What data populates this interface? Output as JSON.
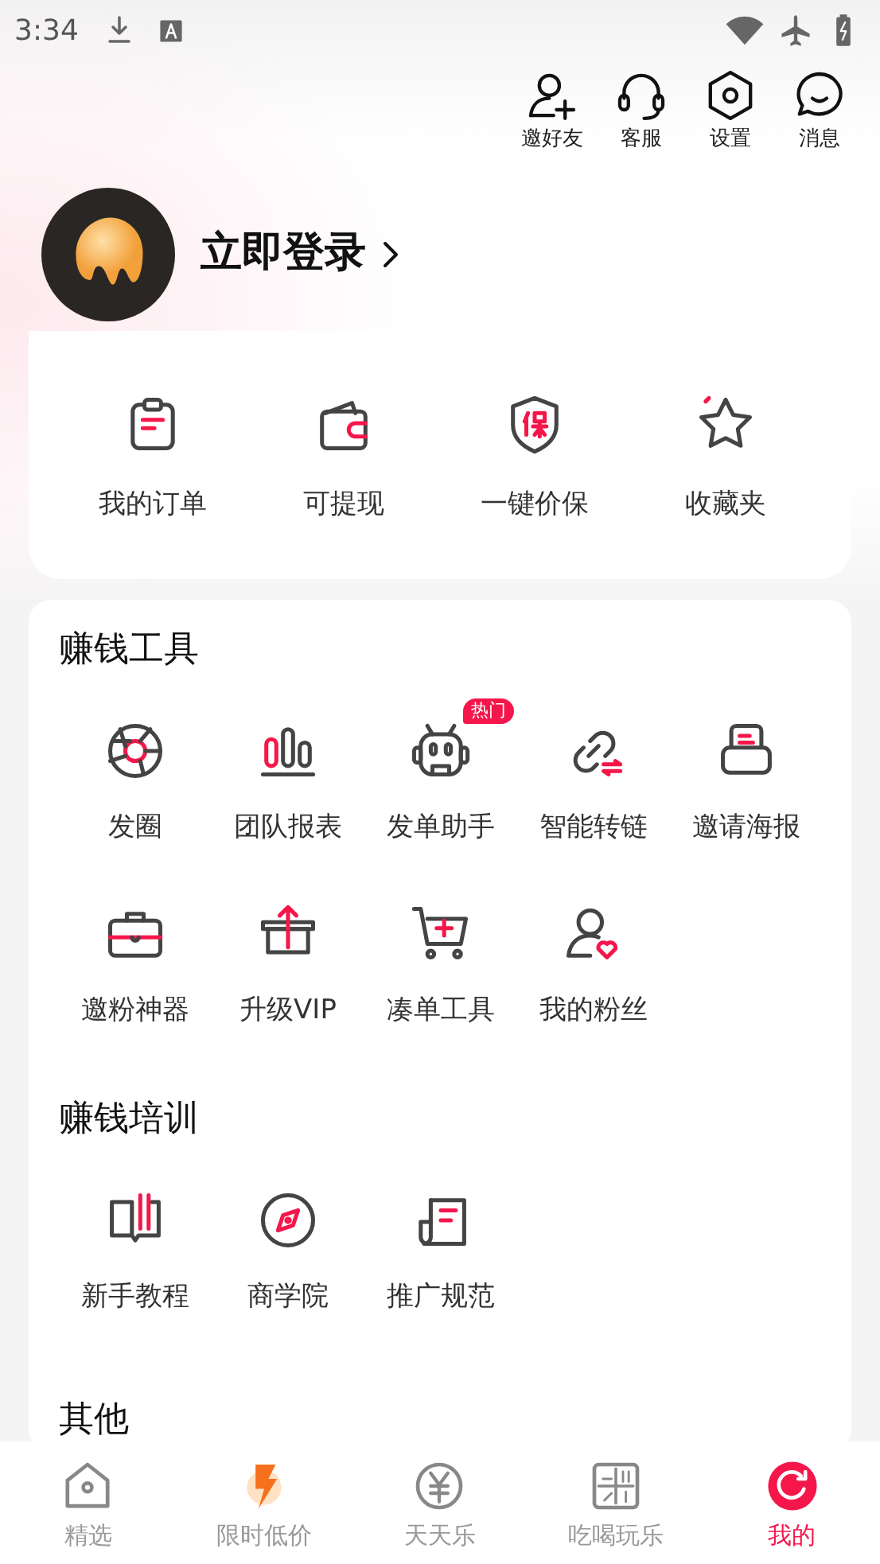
{
  "status_bar": {
    "time": "3:34"
  },
  "top_actions": [
    {
      "label": "邀好友"
    },
    {
      "label": "客服"
    },
    {
      "label": "设置"
    },
    {
      "label": "消息"
    }
  ],
  "profile": {
    "login_text": "立即登录"
  },
  "quick_actions": [
    {
      "label": "我的订单"
    },
    {
      "label": "可提现"
    },
    {
      "label": "一键价保"
    },
    {
      "label": "收藏夹"
    }
  ],
  "sections": [
    {
      "title": "赚钱工具",
      "items": [
        {
          "label": "发圈"
        },
        {
          "label": "团队报表"
        },
        {
          "label": "发单助手",
          "badge": "热门"
        },
        {
          "label": "智能转链"
        },
        {
          "label": "邀请海报"
        },
        {
          "label": "邀粉神器"
        },
        {
          "label": "升级VIP"
        },
        {
          "label": "凑单工具"
        },
        {
          "label": "我的粉丝"
        }
      ]
    },
    {
      "title": "赚钱培训",
      "items": [
        {
          "label": "新手教程"
        },
        {
          "label": "商学院"
        },
        {
          "label": "推广规范"
        }
      ]
    },
    {
      "title": "其他"
    }
  ],
  "tab_bar": [
    {
      "label": "精选",
      "selected": false
    },
    {
      "label": "限时低价",
      "selected": false
    },
    {
      "label": "天天乐",
      "selected": false
    },
    {
      "label": "吃喝玩乐",
      "selected": false
    },
    {
      "label": "我的",
      "selected": true
    }
  ]
}
